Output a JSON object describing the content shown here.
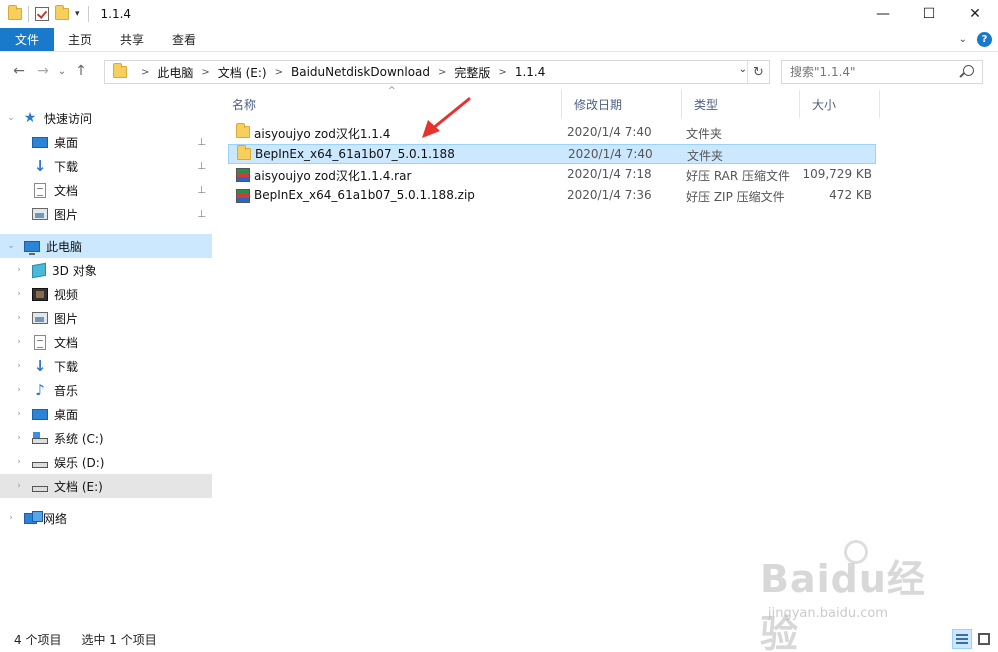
{
  "window": {
    "title": "1.1.4",
    "minimize": "—",
    "maximize": "☐",
    "close": "✕"
  },
  "ribbon": {
    "tabs": [
      "文件",
      "主页",
      "共享",
      "查看"
    ],
    "help": "?"
  },
  "nav": {
    "back": "←",
    "forward": "→",
    "recent": "⌄",
    "up": "↑",
    "breadcrumb": [
      "此电脑",
      "文档 (E:)",
      "BaiduNetdiskDownload",
      "完整版",
      "1.1.4"
    ],
    "breadcrumb_sep": ">",
    "refresh": "↻"
  },
  "search": {
    "placeholder": "搜索\"1.1.4\""
  },
  "sidebar": {
    "items": [
      {
        "label": "快速访问",
        "icon": "star-icon"
      },
      {
        "label": "桌面",
        "icon": "desktop-icon",
        "pinned": true
      },
      {
        "label": "下载",
        "icon": "download-icon",
        "pinned": true
      },
      {
        "label": "文档",
        "icon": "document-icon",
        "pinned": true
      },
      {
        "label": "图片",
        "icon": "pictures-icon",
        "pinned": true
      },
      {
        "label": "此电脑",
        "icon": "computer-icon",
        "state": "selected"
      },
      {
        "label": "3D 对象",
        "icon": "3d-objects-icon"
      },
      {
        "label": "视频",
        "icon": "video-icon"
      },
      {
        "label": "图片",
        "icon": "pictures-icon"
      },
      {
        "label": "文档",
        "icon": "document-icon"
      },
      {
        "label": "下载",
        "icon": "download-icon"
      },
      {
        "label": "音乐",
        "icon": "music-icon"
      },
      {
        "label": "桌面",
        "icon": "desktop-icon"
      },
      {
        "label": "系统 (C:)",
        "icon": "system-drive-icon"
      },
      {
        "label": "娱乐 (D:)",
        "icon": "drive-icon"
      },
      {
        "label": "文档 (E:)",
        "icon": "drive-icon",
        "state": "hover"
      },
      {
        "label": "网络",
        "icon": "network-icon"
      }
    ],
    "pin_glyph": "📌"
  },
  "columns": {
    "name": "名称",
    "date": "修改日期",
    "type": "类型",
    "size": "大小",
    "sort_glyph": "^"
  },
  "files": [
    {
      "name": "aisyoujyo zod汉化1.1.4",
      "date": "2020/1/4 7:40",
      "type": "文件夹",
      "size": "",
      "icon": "folder-icon"
    },
    {
      "name": "BepInEx_x64_61a1b07_5.0.1.188",
      "date": "2020/1/4 7:40",
      "type": "文件夹",
      "size": "",
      "icon": "folder-icon",
      "selected": true
    },
    {
      "name": "aisyoujyo zod汉化1.1.4.rar",
      "date": "2020/1/4 7:18",
      "type": "好压 RAR 压缩文件",
      "size": "109,729 KB",
      "icon": "archive-icon"
    },
    {
      "name": "BepInEx_x64_61a1b07_5.0.1.188.zip",
      "date": "2020/1/4 7:36",
      "type": "好压 ZIP 压缩文件",
      "size": "472 KB",
      "icon": "archive-icon"
    }
  ],
  "status": {
    "count": "4 个项目",
    "selected": "选中 1 个项目"
  },
  "watermark": {
    "brand": "Baidu经验",
    "url": "jingyan.baidu.com"
  },
  "colors": {
    "accent": "#1979ca",
    "selection": "#cce8ff",
    "annotation_arrow": "#e8322e"
  }
}
